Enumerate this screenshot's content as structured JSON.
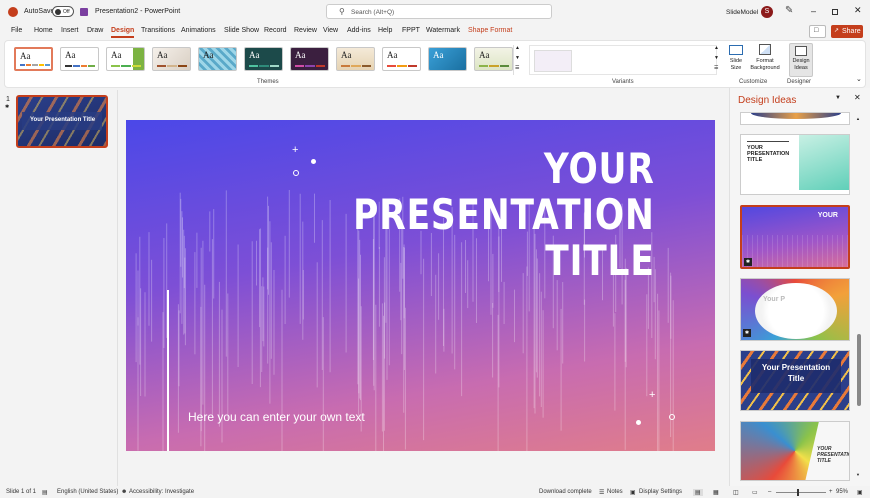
{
  "titlebar": {
    "autosave_label": "AutoSave",
    "autosave_state": "Off",
    "doc_title": "Presentation2 - PowerPoint",
    "search_placeholder": "Search (Alt+Q)",
    "user_name": "SlideModel",
    "user_initial": "S"
  },
  "tabs": [
    "File",
    "Home",
    "Insert",
    "Draw",
    "Design",
    "Transitions",
    "Animations",
    "Slide Show",
    "Record",
    "Review",
    "View",
    "Add-ins",
    "Help",
    "FPPT",
    "Watermark",
    "Shape Format"
  ],
  "active_tab": "Design",
  "share_label": "Share",
  "ribbon": {
    "theme_label": "Aa",
    "themes_group": "Themes",
    "variants_group": "Variants",
    "customize_group": "Customize",
    "designer_group": "Designer",
    "slide_size": "Slide Size",
    "format_background": "Format Background",
    "design_ideas_btn": "Design Ideas"
  },
  "slide_panel": {
    "slide_number": "1",
    "thumb_title": "Your Presentation Title"
  },
  "slide": {
    "title_line1": "YOUR",
    "title_line2": "PRESENTATION",
    "title_line3": "TITLE",
    "subtitle": "Here you can enter your own text"
  },
  "design_ideas": {
    "title": "Design Ideas",
    "idea2_title": "YOUR PRESENTATION TITLE",
    "idea3_title": "YOUR",
    "idea4_title": "Your P",
    "idea5_title": "Your Presentation Title",
    "idea6_title": "YOUR PRESENTATION TITLE"
  },
  "status": {
    "slide_of": "Slide 1 of 1",
    "language": "English (United States)",
    "accessibility": "Accessibility: Investigate",
    "download": "Download complete",
    "notes": "Notes",
    "display": "Display Settings",
    "zoom": "95%"
  },
  "colors": {
    "accent": "#c43e1c",
    "slide_top": "#4b48e8",
    "slide_bottom": "#e07d8a"
  }
}
